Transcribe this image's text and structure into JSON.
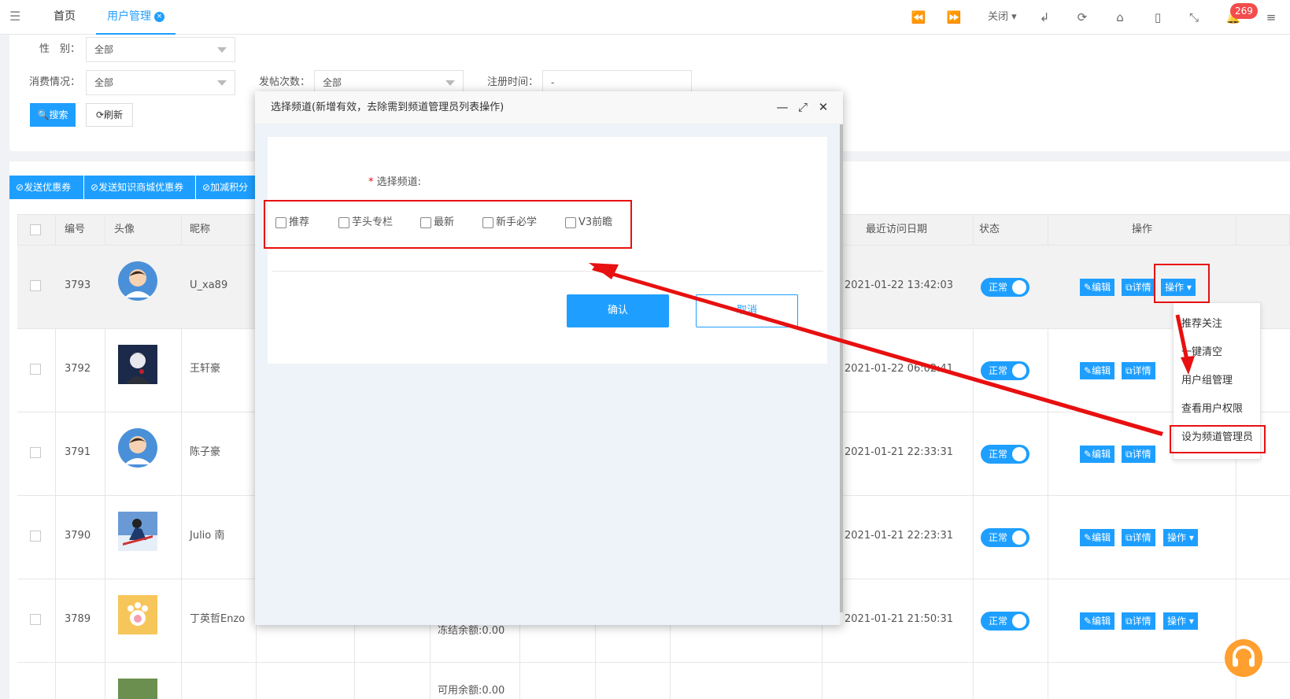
{
  "header": {
    "tabs": [
      {
        "label": "首页"
      },
      {
        "label": "用户管理"
      }
    ],
    "close_label": "关闭",
    "notification_count": "269"
  },
  "filters": {
    "gender_label": "性　别：",
    "gender_value": "全部",
    "consume_label": "消费情况：",
    "consume_value": "全部",
    "post_label": "发帖次数：",
    "post_value": "全部",
    "reg_label": "注册时间：",
    "reg_value": "-",
    "search_label": "搜索",
    "refresh_label": "刷新"
  },
  "actions": [
    {
      "label": "发送优惠券"
    },
    {
      "label": "发送知识商城优惠券"
    },
    {
      "label": "加减积分"
    }
  ],
  "table": {
    "headers": {
      "id": "编号",
      "avatar": "头像",
      "nick": "昵称",
      "last_visit": "最近访问日期",
      "status": "状态",
      "ops": "操作"
    },
    "rows": [
      {
        "id": "3793",
        "nick": "U_xa89",
        "last_visit": "2021-01-22 13:42:03",
        "status": "正常"
      },
      {
        "id": "3792",
        "nick": "王轩豪",
        "last_visit": "2021-01-22 06:02:41",
        "status": "正常"
      },
      {
        "id": "3791",
        "nick": "陈子豪",
        "last_visit": "2021-01-21 22:33:31",
        "status": "正常"
      },
      {
        "id": "3790",
        "nick": "Julio 南",
        "last_visit": "2021-01-21 22:23:31",
        "status": "正常"
      },
      {
        "id": "3789",
        "nick": "丁英哲Enzo",
        "last_visit": "2021-01-21 21:50:31",
        "status": "正常",
        "extra": "冻结余额:0.00"
      },
      {
        "extra": "可用余额:0.00"
      }
    ],
    "edit_label": "编辑",
    "detail_label": "详情",
    "op_label": "操作"
  },
  "dropdown": {
    "items": [
      {
        "label": "推荐关注"
      },
      {
        "label": "一键清空"
      },
      {
        "label": "用户组管理"
      },
      {
        "label": "查看用户权限"
      },
      {
        "label": "设为频道管理员"
      }
    ]
  },
  "modal": {
    "title": "选择频道(新增有效，去除需到频道管理员列表操作)",
    "field_label": "选择频道:",
    "required_mark": "*",
    "options": [
      {
        "label": "推荐"
      },
      {
        "label": "芋头专栏"
      },
      {
        "label": "最新"
      },
      {
        "label": "新手必学"
      },
      {
        "label": "V3前瞻"
      }
    ],
    "confirm_label": "确认",
    "cancel_label": "取消"
  },
  "colors": {
    "primary": "#1e9fff",
    "annotation": "#e81010",
    "badge": "#f24c4c"
  }
}
